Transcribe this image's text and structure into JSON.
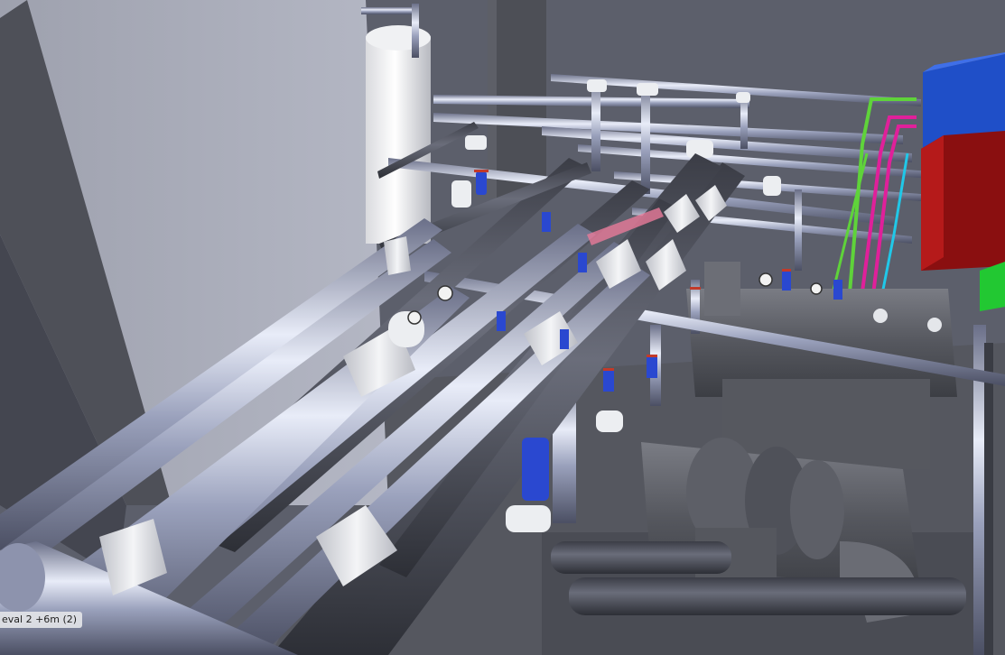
{
  "viewport": {
    "level_label": "eval 2  +6m (2)"
  },
  "colors": {
    "background": "#5b5e6a",
    "wall": "#a9acb8",
    "column": "#505259",
    "pipe_silver": "#aab0c8",
    "pipe_insulated": "#4a4c57",
    "pipe_white": "#e4e6ea",
    "valve": "#2a48d0",
    "equipment_grey": "#5a5c63",
    "panel_blue": "#1f4fc8",
    "panel_red": "#8a0f10",
    "panel_green": "#22c832",
    "line_magenta": "#e0209a",
    "line_green": "#5fd33a",
    "line_cyan": "#20c8e8"
  },
  "icons": [
    "valve-icon",
    "pressure-gauge-icon"
  ]
}
